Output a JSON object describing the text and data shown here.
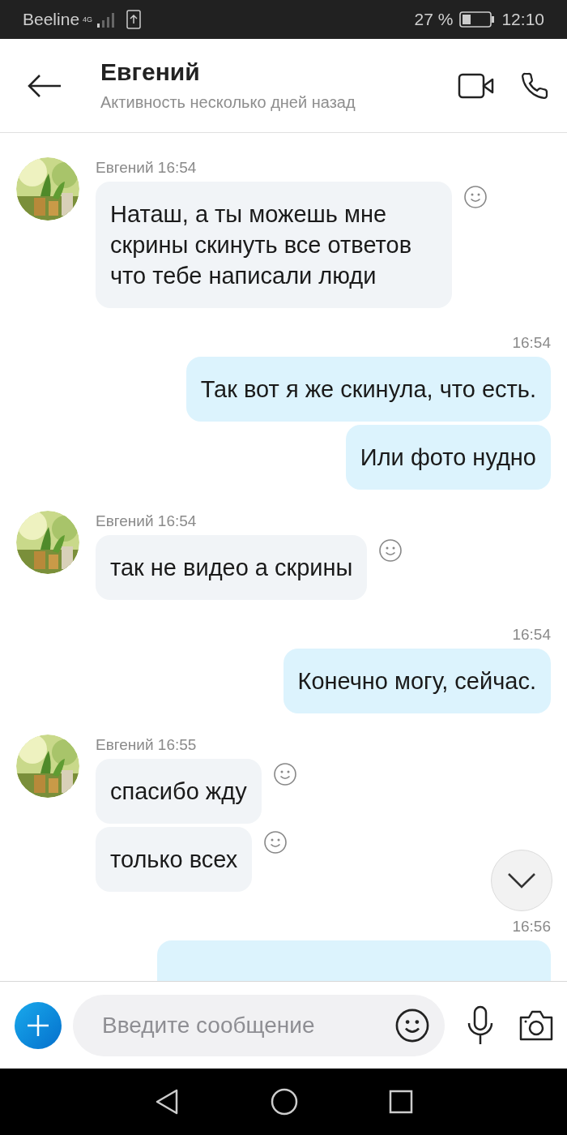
{
  "status_bar": {
    "carrier": "Beeline",
    "network": "4G",
    "battery": "27 %",
    "time": "12:10"
  },
  "header": {
    "name": "Евгений",
    "status": "Активность несколько дней назад"
  },
  "messages": [
    {
      "kind": "incoming",
      "sender": "Евгений 16:54",
      "bubbles": [
        "Наташ, а ты можешь мне скрины скинуть все ответов что тебе написали люди"
      ]
    },
    {
      "kind": "outgoing",
      "time": "16:54",
      "bubbles": [
        "Так вот я же скинула, что есть.",
        "Или фото нудно"
      ]
    },
    {
      "kind": "incoming",
      "sender": "Евгений 16:54",
      "bubbles": [
        "так не видео а скрины"
      ]
    },
    {
      "kind": "outgoing",
      "time": "16:54",
      "bubbles": [
        "Конечно могу, сейчас."
      ]
    },
    {
      "kind": "incoming",
      "sender": "Евгений 16:55",
      "bubbles": [
        "спасибо жду",
        "только всех"
      ]
    },
    {
      "kind": "outgoing",
      "time": "16:56"
    }
  ],
  "composer": {
    "placeholder": "Введите сообщение"
  }
}
